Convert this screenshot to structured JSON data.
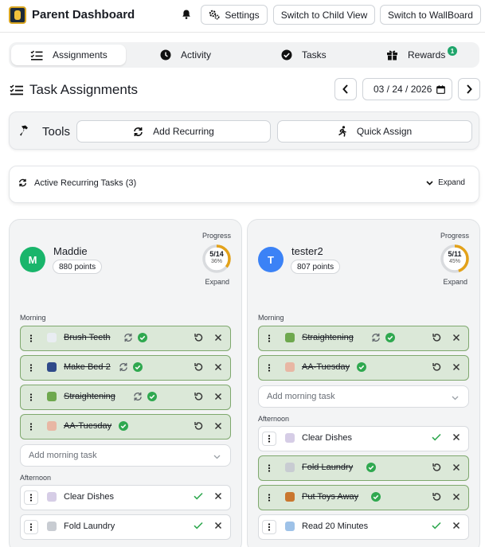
{
  "header": {
    "title": "Parent Dashboard",
    "settings_label": "Settings",
    "child_view_label": "Switch to Child View",
    "wallboard_label": "Switch to WallBoard"
  },
  "tabs": [
    {
      "label": "Assignments",
      "active": true
    },
    {
      "label": "Activity"
    },
    {
      "label": "Tasks"
    },
    {
      "label": "Rewards",
      "badge": "1"
    }
  ],
  "section": {
    "title": "Task Assignments",
    "date": "03 / 24 / 2026"
  },
  "tools": {
    "label": "Tools",
    "add_recurring": "Add Recurring",
    "quick_assign": "Quick Assign"
  },
  "recurring": {
    "label": "Active Recurring Tasks (3)",
    "expand": "Expand"
  },
  "children": [
    {
      "initial": "M",
      "name": "Maddie",
      "points": "880 points",
      "progress_label": "Progress",
      "progress_text": "5/14",
      "progress_pct": "36%",
      "progress_fraction": 0.36,
      "expand": "Expand",
      "avatar_color": "#19b56b",
      "morning_label": "Morning",
      "morning": [
        {
          "name": "Brush Teeth",
          "done": true,
          "recurring": true,
          "icon": "toothbrush-icon"
        },
        {
          "name": "Make Bed 2",
          "done": true,
          "recurring": true,
          "icon": "bed-icon"
        },
        {
          "name": "Straightening",
          "done": true,
          "recurring": true,
          "icon": "books-icon"
        },
        {
          "name": "AA-Tuesday",
          "done": true,
          "recurring": false,
          "icon": "hamster-icon"
        }
      ],
      "add_morning": "Add morning task",
      "afternoon_label": "Afternoon",
      "afternoon": [
        {
          "name": "Clear Dishes",
          "done": false,
          "icon": "plate-icon"
        },
        {
          "name": "Fold Laundry",
          "done": false,
          "icon": "laundry-icon"
        }
      ]
    },
    {
      "initial": "T",
      "name": "tester2",
      "points": "807 points",
      "progress_label": "Progress",
      "progress_text": "5/11",
      "progress_pct": "45%",
      "progress_fraction": 0.45,
      "expand": "Expand",
      "avatar_color": "#3b82f6",
      "morning_label": "Morning",
      "morning": [
        {
          "name": "Straightening",
          "done": true,
          "recurring": true,
          "icon": "books-icon"
        },
        {
          "name": "AA-Tuesday",
          "done": true,
          "recurring": false,
          "icon": "hamster-icon"
        }
      ],
      "add_morning": "Add morning task",
      "afternoon_label": "Afternoon",
      "afternoon": [
        {
          "name": "Clear Dishes",
          "done": false,
          "icon": "plate-icon"
        },
        {
          "name": "Fold Laundry",
          "done": true,
          "icon": "laundry-icon"
        },
        {
          "name": "Put Toys Away",
          "done": true,
          "icon": "teddy-bear-icon"
        },
        {
          "name": "Read 20 Minutes",
          "done": false,
          "icon": "book-icon"
        }
      ]
    }
  ],
  "colors": {
    "done_bg": "#dbe8d8",
    "done_border": "#7fa86e",
    "check_green": "#2fa84f",
    "progress_ring": "#e3a21a"
  }
}
